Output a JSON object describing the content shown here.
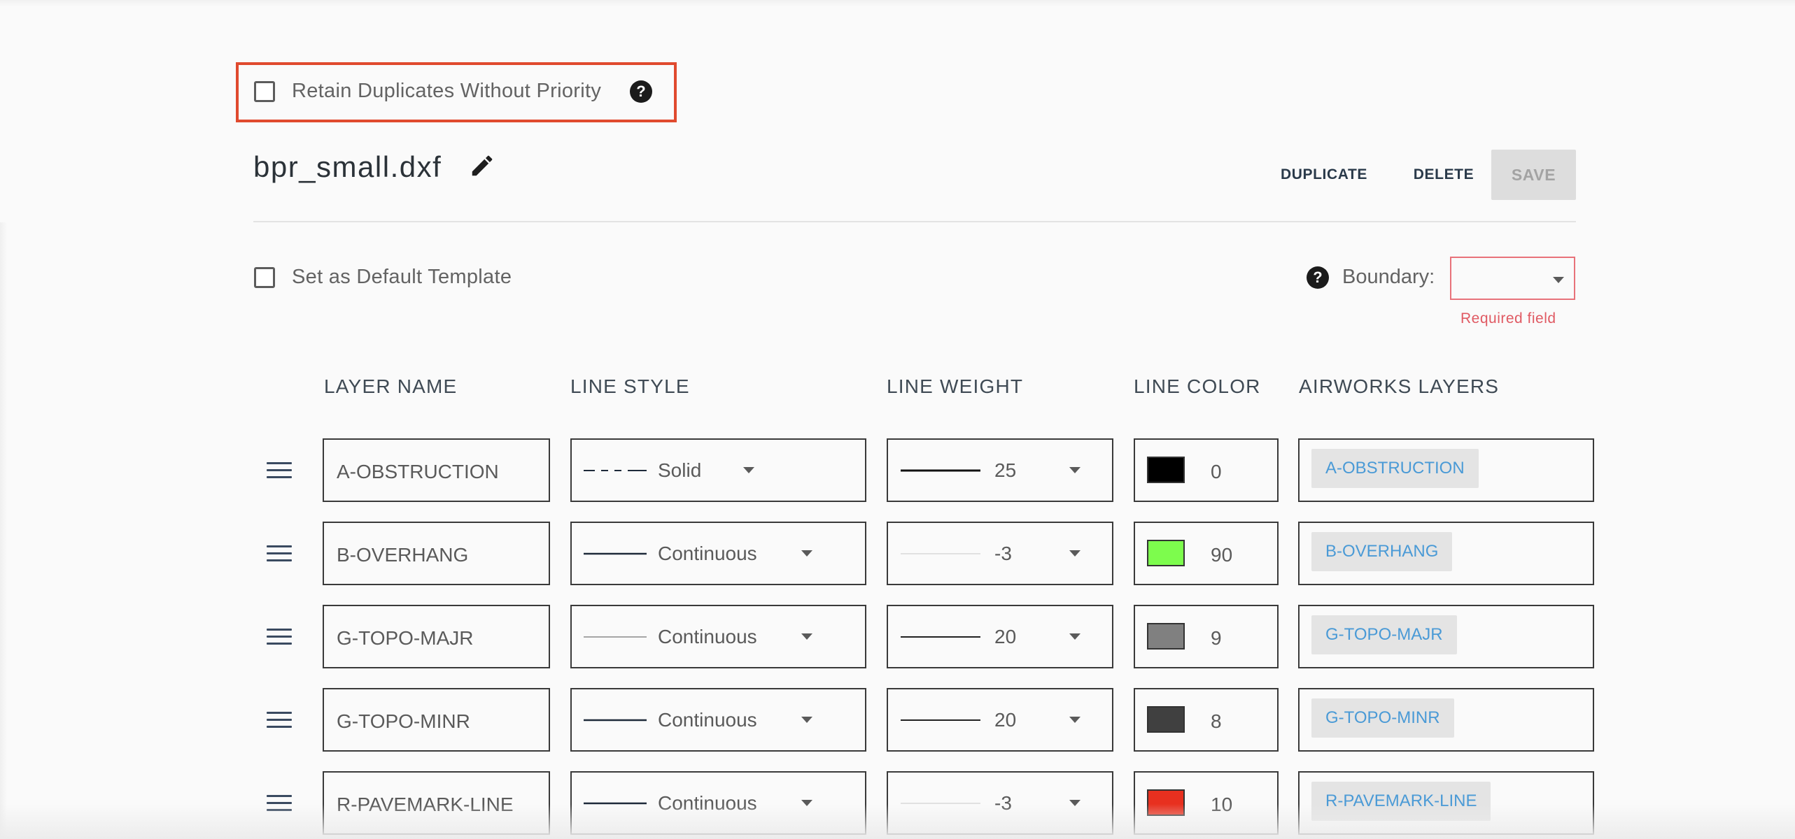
{
  "options": {
    "retain_duplicates_label": "Retain Duplicates Without Priority",
    "set_default_label": "Set as Default Template"
  },
  "header": {
    "file_name": "bpr_small.dxf",
    "duplicate_label": "DUPLICATE",
    "delete_label": "DELETE",
    "save_label": "SAVE"
  },
  "boundary": {
    "label": "Boundary:",
    "value": "",
    "error": "Required field"
  },
  "table": {
    "columns": [
      "LAYER NAME",
      "LINE STYLE",
      "LINE WEIGHT",
      "LINE COLOR",
      "AIRWORKS LAYERS"
    ],
    "rows": [
      {
        "layer_name": "A-OBSTRUCTION",
        "line_style": "Solid",
        "line_style_pattern": "dashed",
        "line_weight": "25",
        "line_weight_preview": "thick",
        "color_value": "0",
        "color_hex": "#000000",
        "airworks_layer": "A-OBSTRUCTION"
      },
      {
        "layer_name": "B-OVERHANG",
        "line_style": "Continuous",
        "line_style_pattern": "solid-dark",
        "line_weight": "-3",
        "line_weight_preview": "hairline",
        "color_value": "90",
        "color_hex": "#7dfc4d",
        "airworks_layer": "B-OVERHANG"
      },
      {
        "layer_name": "G-TOPO-MAJR",
        "line_style": "Continuous",
        "line_style_pattern": "solid-gray",
        "line_weight": "20",
        "line_weight_preview": "medium",
        "color_value": "9",
        "color_hex": "#808080",
        "airworks_layer": "G-TOPO-MAJR"
      },
      {
        "layer_name": "G-TOPO-MINR",
        "line_style": "Continuous",
        "line_style_pattern": "solid-dark",
        "line_weight": "20",
        "line_weight_preview": "medium",
        "color_value": "8",
        "color_hex": "#404040",
        "airworks_layer": "G-TOPO-MINR"
      },
      {
        "layer_name": "R-PAVEMARK-LINE",
        "line_style": "Continuous",
        "line_style_pattern": "solid-dark",
        "line_weight": "-3",
        "line_weight_preview": "hairline",
        "color_value": "10",
        "color_hex": "#e8301f",
        "airworks_layer": "R-PAVEMARK-LINE"
      }
    ]
  }
}
